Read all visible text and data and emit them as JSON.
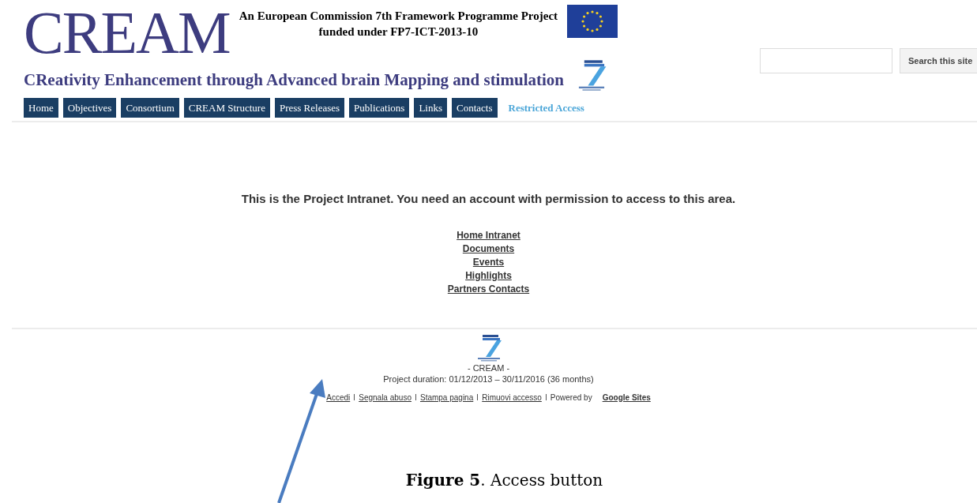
{
  "header": {
    "logo": "CREAM",
    "funding_line_1": "An European Commission 7th Framework Programme Project",
    "funding_line_2": "funded under FP7-ICT-2013-10",
    "subtitle": "CReativity Enhancement through Advanced brain Mapping and stimulation"
  },
  "search": {
    "button": "Search this site"
  },
  "nav": [
    {
      "label": "Home",
      "selected": false
    },
    {
      "label": "Objectives",
      "selected": false
    },
    {
      "label": "Consortium",
      "selected": false
    },
    {
      "label": "CREAM Structure",
      "selected": false
    },
    {
      "label": "Press Releases",
      "selected": false
    },
    {
      "label": "Publications",
      "selected": false
    },
    {
      "label": "Links",
      "selected": false
    },
    {
      "label": "Contacts",
      "selected": false
    },
    {
      "label": "Restricted Access",
      "selected": true
    }
  ],
  "main": {
    "notice": "This is the Project Intranet. You need an account with permission to access to this area.",
    "links": [
      "Home Intranet",
      "Documents",
      "Events",
      "Highlights",
      "Partners Contacts"
    ]
  },
  "footer": {
    "name": "- CREAM -",
    "duration": "Project duration: 01/12/2013 – 30/11/2016 (36 months)",
    "items": [
      {
        "kind": "link",
        "text": "Accedi"
      },
      {
        "kind": "link",
        "text": "Segnala abuso"
      },
      {
        "kind": "link",
        "text": "Stampa pagina"
      },
      {
        "kind": "link",
        "text": "Rimuovi accesso"
      },
      {
        "kind": "text",
        "text": "Powered by"
      },
      {
        "kind": "brand",
        "text": "Google Sites"
      }
    ]
  },
  "caption": "**Figure 5**. Access button"
}
